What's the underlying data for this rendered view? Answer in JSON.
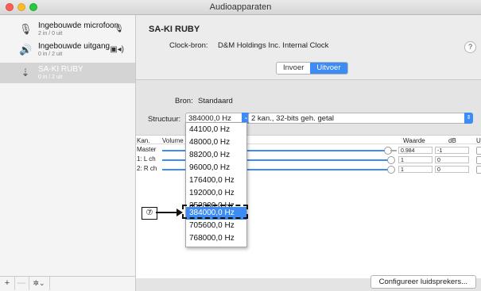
{
  "window": {
    "title": "Audioapparaten"
  },
  "sidebar": {
    "devices": [
      {
        "name": "Ingebouwde microfoon",
        "sub": "2 in / 0 uit",
        "icon": "microphone-icon",
        "right_icon": "mic-indicator-icon"
      },
      {
        "name": "Ingebouwde uitgang",
        "sub": "0 in / 2 uit",
        "icon": "speaker-icon",
        "right_icon": "finder-speaker-icon"
      },
      {
        "name": "SA-KI RUBY",
        "sub": "0 in / 2 uit",
        "icon": "usb-icon",
        "selected": true
      }
    ],
    "buttons": {
      "add": "+",
      "remove": "—",
      "gear": "✲⌄"
    }
  },
  "main": {
    "device_name": "SA-KI RUBY",
    "clock_label": "Clock-bron:",
    "clock_value": "D&M Holdings Inc. Internal Clock",
    "help": "?",
    "tabs": [
      {
        "label": "Invoer",
        "active": false
      },
      {
        "label": "Uitvoer",
        "active": true
      }
    ],
    "source_label": "Bron:",
    "source_value": "Standaard",
    "structure_label": "Structuur:",
    "rate_value": "384000,0 Hz",
    "format_value": "2 kan., 32-bits geh. getal",
    "table": {
      "headers": {
        "kan": "Kan.",
        "volume": "Volume",
        "waarde": "Waarde",
        "db": "dB",
        "u": "U"
      },
      "rows": [
        {
          "channel": "Master",
          "value": "0.984",
          "db": "-1"
        },
        {
          "channel": "1: L ch",
          "value": "1",
          "db": "0"
        },
        {
          "channel": "2: R ch",
          "value": "1",
          "db": "0"
        }
      ]
    },
    "configure_button": "Configureer luidsprekers..."
  },
  "dropdown": {
    "options": [
      "44100,0 Hz",
      "48000,0 Hz",
      "88200,0 Hz",
      "96000,0 Hz",
      "176400,0 Hz",
      "192000,0 Hz",
      "352800,0 Hz",
      "384000,0 Hz",
      "705600,0 Hz",
      "768000,0 Hz"
    ],
    "highlighted_index": 7
  },
  "callout": {
    "label": "⑦"
  },
  "colors": {
    "accent": "#3d8bf5"
  }
}
